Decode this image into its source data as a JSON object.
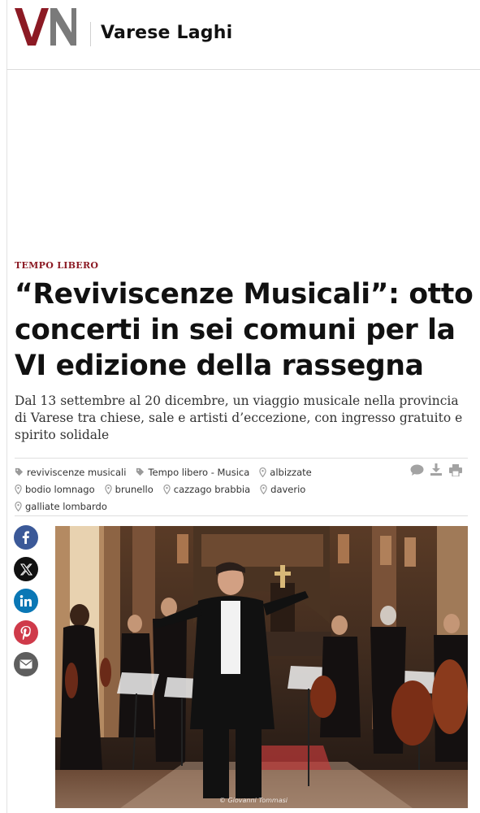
{
  "header": {
    "logo_text": "VN",
    "site_name": "Varese Laghi"
  },
  "article": {
    "category": "TEMPO LIBERO",
    "headline": "“Reviviscenze Musicali”: otto concerti in sei comuni per la VI edizione della rassegna",
    "subtitle": "Dal 13 settembre al 20 dicembre, un viaggio musicale nella provincia di Varese tra chiese, sale e artisti d’eccezione, con ingresso gratuito e spirito solidale",
    "tags_row1": [
      {
        "label": "reviviscenze musicali",
        "icon": "tag-icon"
      },
      {
        "label": "Tempo libero - Musica",
        "icon": "tag-icon"
      },
      {
        "label": "albizzate",
        "icon": "location-pin-icon"
      }
    ],
    "tags_row2": [
      {
        "label": "bodio lomnago",
        "icon": "location-pin-icon"
      },
      {
        "label": "brunello",
        "icon": "location-pin-icon"
      },
      {
        "label": "cazzago brabbia",
        "icon": "location-pin-icon"
      },
      {
        "label": "daverio",
        "icon": "location-pin-icon"
      }
    ],
    "tags_row3": [
      {
        "label": "galliate lombardo",
        "icon": "location-pin-icon"
      }
    ],
    "tools": [
      "comment-icon",
      "download-icon",
      "print-icon"
    ],
    "share": [
      "facebook-icon",
      "x-icon",
      "linkedin-icon",
      "pinterest-icon",
      "email-icon"
    ],
    "photo_credit": "© Giovanni Tommasi"
  },
  "colors": {
    "logo_v": "#8c1a24",
    "logo_n": "#7a7a7a",
    "category": "#8c1a24",
    "facebook": "#3b5998",
    "x": "#111111",
    "linkedin": "#0a77b5",
    "pinterest": "#cf3a4a",
    "email": "#5e5e5e"
  }
}
